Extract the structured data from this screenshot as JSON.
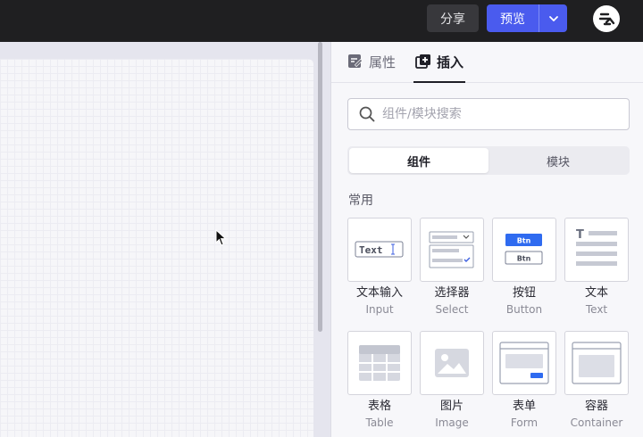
{
  "topbar": {
    "share_label": "分享",
    "preview_label": "预览"
  },
  "panel": {
    "tabs": [
      {
        "label": "属性",
        "icon": "edit-icon",
        "active": false
      },
      {
        "label": "插入",
        "icon": "insert-icon",
        "active": true
      }
    ],
    "search": {
      "placeholder": "组件/模块搜索",
      "value": ""
    },
    "segments": [
      {
        "label": "组件",
        "active": true
      },
      {
        "label": "模块",
        "active": false
      }
    ],
    "section_title": "常用",
    "components": [
      {
        "label": "文本输入",
        "sub": "Input",
        "icon": "text-input-icon",
        "preview_text": "Text"
      },
      {
        "label": "选择器",
        "sub": "Select",
        "icon": "select-icon"
      },
      {
        "label": "按钮",
        "sub": "Button",
        "icon": "button-icon",
        "preview_text": "Btn"
      },
      {
        "label": "文本",
        "sub": "Text",
        "icon": "text-icon",
        "preview_text": "T"
      },
      {
        "label": "表格",
        "sub": "Table",
        "icon": "table-icon"
      },
      {
        "label": "图片",
        "sub": "Image",
        "icon": "image-icon"
      },
      {
        "label": "表单",
        "sub": "Form",
        "icon": "form-icon"
      },
      {
        "label": "容器",
        "sub": "Container",
        "icon": "container-icon"
      }
    ]
  },
  "colors": {
    "topbar_bg": "#1f1f21",
    "primary": "#4a5bee",
    "button_blue": "#2f6bf0",
    "panel_bg": "#f7f7fa"
  }
}
